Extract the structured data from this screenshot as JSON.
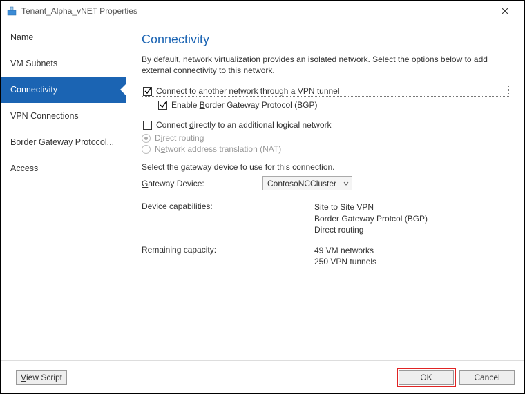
{
  "titlebar": {
    "title": "Tenant_Alpha_vNET Properties"
  },
  "sidebar": {
    "items": [
      {
        "label": "Name",
        "key": "name"
      },
      {
        "label": "VM Subnets",
        "key": "vm-subnets"
      },
      {
        "label": "Connectivity",
        "key": "connectivity",
        "selected": true
      },
      {
        "label": "VPN Connections",
        "key": "vpn-connections"
      },
      {
        "label": "Border Gateway Protocol...",
        "key": "bgp"
      },
      {
        "label": "Access",
        "key": "access"
      }
    ]
  },
  "page": {
    "title": "Connectivity",
    "description": "By default, network virtualization provides an isolated network. Select the options below to add external connectivity to this network.",
    "vpn_checkbox_label_pre": "C",
    "vpn_checkbox_label_key": "o",
    "vpn_checkbox_label_post": "nnect to another network through a VPN tunnel",
    "vpn_checked": true,
    "bgp_label_pre": "Enable ",
    "bgp_label_key": "B",
    "bgp_label_post": "order Gateway Protocol (BGP)",
    "bgp_checked": true,
    "direct_label_pre": "Connect ",
    "direct_label_key": "d",
    "direct_label_post": "irectly to an additional logical network",
    "direct_checked": false,
    "routing_label_pre": "D",
    "routing_label_key": "i",
    "routing_label_post": "rect routing",
    "routing_selected": true,
    "nat_label_pre": "N",
    "nat_label_key": "e",
    "nat_label_post": "twork address translation (NAT)",
    "nat_selected": false,
    "gateway_prompt": "Select the gateway device to use for this connection.",
    "gateway_label_pre": "",
    "gateway_label_key": "G",
    "gateway_label_post": "ateway Device:",
    "gateway_value": "ContosoNCCluster",
    "capabilities_label": "Device capabilities:",
    "capabilities_lines": [
      "Site to Site VPN",
      "Border Gateway Protcol (BGP)",
      "Direct routing"
    ],
    "capacity_label": "Remaining capacity:",
    "capacity_lines": [
      "49 VM networks",
      "250 VPN tunnels"
    ]
  },
  "footer": {
    "view_script_pre": "",
    "view_script_key": "V",
    "view_script_post": "iew Script",
    "ok": "OK",
    "cancel": "Cancel"
  }
}
